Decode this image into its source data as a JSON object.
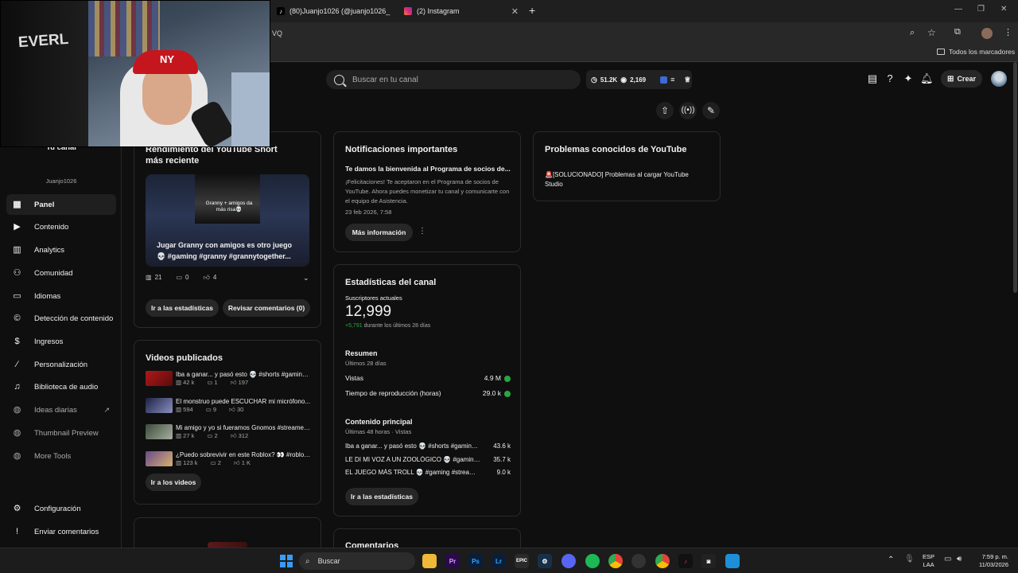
{
  "browser": {
    "tabs": [
      {
        "label": "(80)Juanjo1026 (@juanjo1026_",
        "icon": "tiktok-icon"
      },
      {
        "label": "(2) Instagram",
        "icon": "instagram-icon"
      }
    ],
    "new_tab": "+",
    "url_fragment": "VQ",
    "bookmarks_label": "Todos los marcadores"
  },
  "header": {
    "search_placeholder": "Buscar en tu canal",
    "stat_subs": "51.2K",
    "stat_views": "2,169",
    "create_label": "Crear"
  },
  "sidebar": {
    "channel_title": "Tu canal",
    "channel_handle": "Juanjo1026",
    "items": [
      {
        "label": "Panel",
        "icon": "dashboard-icon"
      },
      {
        "label": "Contenido",
        "icon": "content-icon"
      },
      {
        "label": "Analytics",
        "icon": "analytics-icon"
      },
      {
        "label": "Comunidad",
        "icon": "community-icon"
      },
      {
        "label": "Idiomas",
        "icon": "subtitles-icon"
      },
      {
        "label": "Detección de contenido",
        "icon": "copyright-icon"
      },
      {
        "label": "Ingresos",
        "icon": "dollar-icon"
      },
      {
        "label": "Personalización",
        "icon": "magic-wand-icon"
      },
      {
        "label": "Biblioteca de audio",
        "icon": "audio-library-icon"
      },
      {
        "label": "Ideas diarias",
        "icon": "ideas-icon"
      },
      {
        "label": "Thumbnail Preview",
        "icon": "extension-icon"
      },
      {
        "label": "More Tools",
        "icon": "extension-icon"
      },
      {
        "label": "Configuración",
        "icon": "gear-icon"
      },
      {
        "label": "Enviar comentarios",
        "icon": "feedback-icon"
      }
    ]
  },
  "short_card": {
    "title": "Rendimiento del YouTube Short más reciente",
    "thumb_caption": "Granny + amigos da más risa💀",
    "video_title": "Jugar Granny con amigos es otro juego 💀 #gaming #granny #grannytogether...",
    "views": "21",
    "comments": "0",
    "likes": "4",
    "btn_stats": "Ir a las estadísticas",
    "btn_comments": "Revisar comentarios (0)"
  },
  "videos_card": {
    "title": "Videos publicados",
    "items": [
      {
        "title": "Iba a ganar... y pasó esto 💀 #shorts #gaminge...",
        "views": "42 k",
        "comments": "1",
        "likes": "197"
      },
      {
        "title": "El monstruo puede ESCUCHAR mi micrófono... ",
        "views": "594",
        "comments": "9",
        "likes": "30"
      },
      {
        "title": "Mi amigo y yo si fueramos Gnomos #streamer ...",
        "views": "27 k",
        "comments": "2",
        "likes": "312"
      },
      {
        "title": "¿Puedo sobrevivir en este Roblox? 👀 #roblox ...",
        "views": "123 k",
        "comments": "2",
        "likes": "1 K"
      }
    ],
    "btn": "Ir a los videos"
  },
  "notifications_card": {
    "title": "Notificaciones importantes",
    "headline": "Te damos la bienvenida al Programa de socios de...",
    "body": "¡Felicitaciones! Te aceptaron en el Programa de socios de YouTube. Ahora puedes monetizar tu canal y comunicarte con el equipo de Asistencia.",
    "date": "23 feb 2026, 7:58",
    "btn": "Más información"
  },
  "stats_card": {
    "title": "Estadísticas del canal",
    "subs_label": "Suscriptores actuales",
    "subs_value": "12,999",
    "subs_delta": "+5,791",
    "subs_delta_suffix": "durante los últimos 28 días",
    "summary_title": "Resumen",
    "summary_period": "Últimos 28 días",
    "metrics": [
      {
        "label": "Vistas",
        "value": "4.9 M"
      },
      {
        "label": "Tiempo de reproducción (horas)",
        "value": "29.0 k"
      }
    ],
    "top_title": "Contenido principal",
    "top_period": "Últimas 48 horas · Vistas",
    "top_items": [
      {
        "label": "Iba a ganar... y pasó esto 💀 #shorts #gamingespa...",
        "value": "43.6 k"
      },
      {
        "label": "LE DI MI VOZ A UN ZOOLÓGICO 💀 #gaming #jue...",
        "value": "35.7 k"
      },
      {
        "label": "EL JUEGO MÁS TROLL 💀 #gaming #streamer #vi...",
        "value": "9.0 k"
      }
    ],
    "btn": "Ir a las estadísticas"
  },
  "comments_card": {
    "title": "Comentarios"
  },
  "known_issues_card": {
    "title": "Problemas conocidos de YouTube",
    "item": "🚨[SOLUCIONADO] Problemas al cargar YouTube Studio"
  },
  "taskbar": {
    "search_label": "Buscar",
    "lang_top": "ESP",
    "lang_bottom": "LAA",
    "time": "7:59 p. m.",
    "date": "11/03/2026",
    "apps": [
      "Pr",
      "Ps",
      "Lr"
    ]
  },
  "colors": {
    "accent_green": "#2ba640",
    "bg": "#0f0f0f",
    "card_border": "#2a2a2a"
  }
}
